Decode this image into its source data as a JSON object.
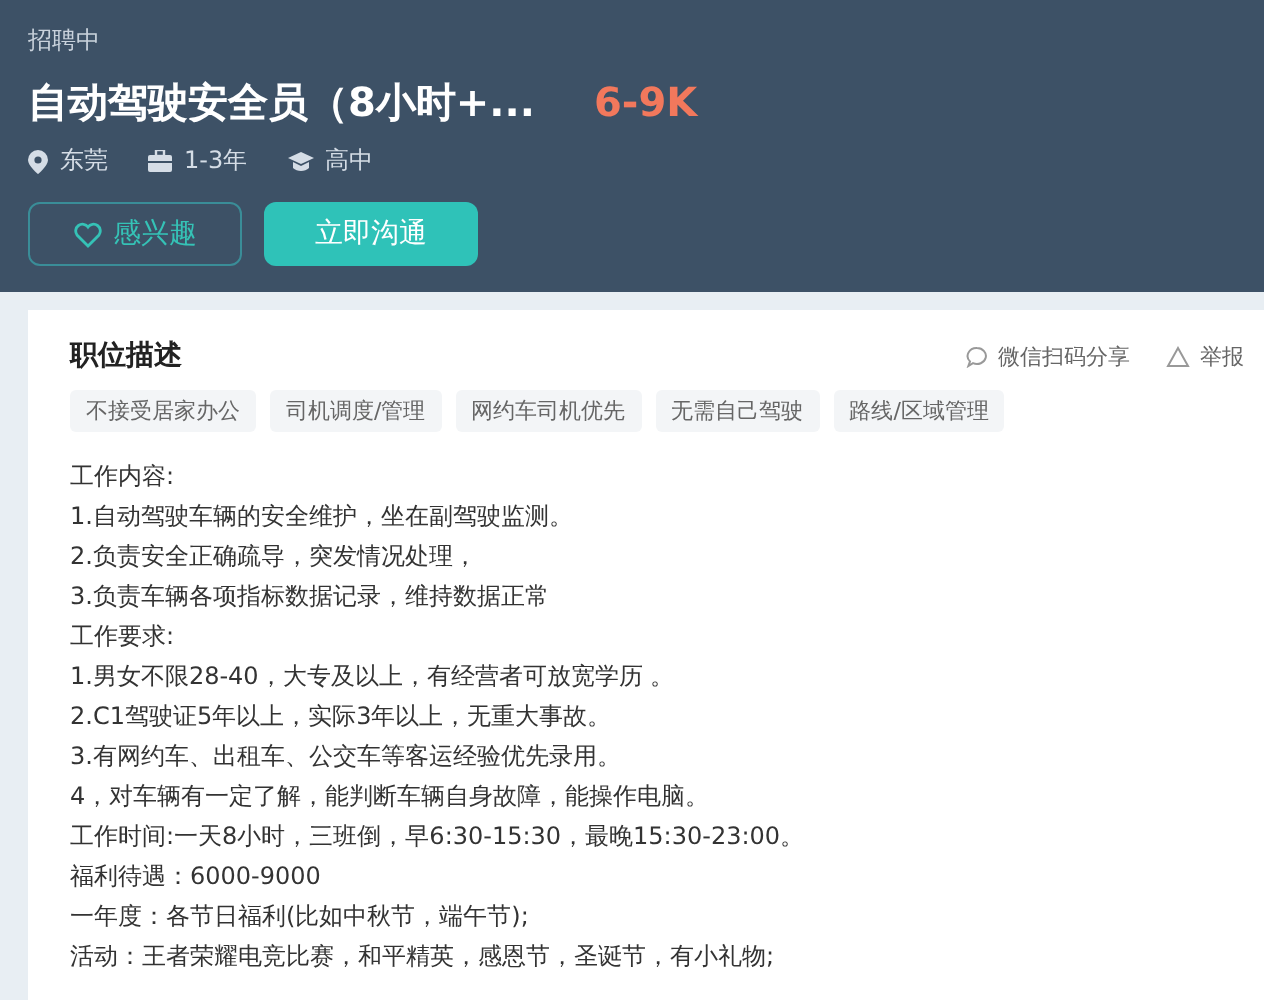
{
  "header": {
    "status": "招聘中",
    "title": "自动驾驶安全员（8小时+...",
    "salary": "6-9K",
    "meta": [
      {
        "kind": "location",
        "text": "东莞"
      },
      {
        "kind": "experience",
        "text": "1-3年"
      },
      {
        "kind": "education",
        "text": "高中"
      }
    ],
    "buttons": [
      {
        "kind": "outline",
        "label": "感兴趣"
      },
      {
        "kind": "primary",
        "label": "立即沟通"
      }
    ]
  },
  "description": {
    "title": "职位描述",
    "actions": [
      {
        "kind": "share",
        "label": "微信扫码分享"
      },
      {
        "kind": "report",
        "label": "举报"
      }
    ],
    "tags": [
      "不接受居家办公",
      "司机调度/管理",
      "网约车司机优先",
      "无需自己驾驶",
      "路线/区域管理"
    ],
    "lines": [
      "工作内容:",
      "1.自动驾驶车辆的安全维护，坐在副驾驶监测。",
      "2.负责安全正确疏导，突发情况处理，",
      "3.负责车辆各项指标数据记录，维持数据正常",
      "工作要求:",
      "1.男女不限28-40，大专及以上，有经营者可放宽学历 。",
      "2.C1驾驶证5年以上，实际3年以上，无重大事故。",
      "3.有网约车、出租车、公交车等客运经验优先录用。",
      "4，对车辆有一定了解，能判断车辆自身故障，能操作电脑。",
      "工作时间:一天8小时，三班倒，早6:30-15:30，最晚15:30-23:00。",
      "福利待遇：6000-9000",
      "一年度：各节日福利(比如中秋节，端午节);",
      "活动：王者荣耀电竞比赛，和平精英，感恩节，圣诞节，有小礼物;"
    ]
  }
}
